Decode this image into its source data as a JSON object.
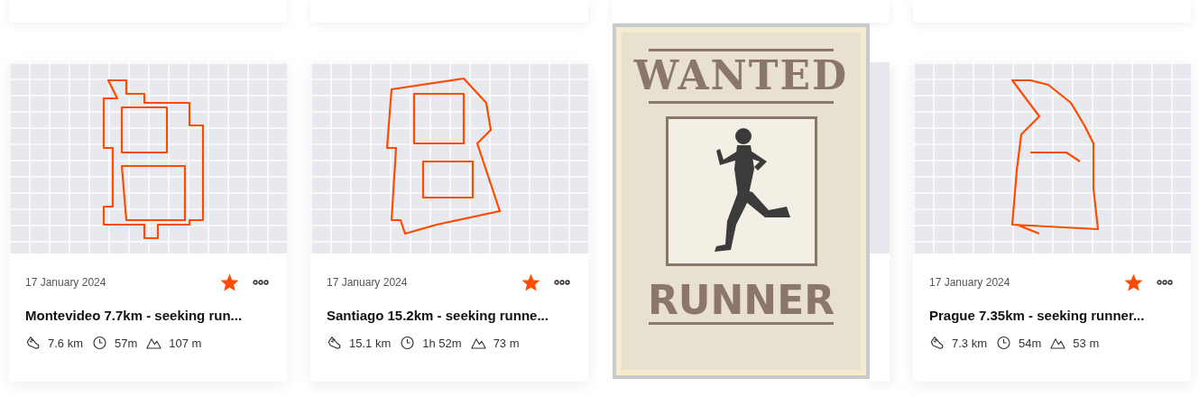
{
  "activities": [
    {
      "kind": "activity",
      "date": "17 January 2024",
      "title": "Montevideo 7.7km - seeking run...",
      "starred": true,
      "distance": "7.6 km",
      "duration": "57m",
      "elevation": "107 m"
    },
    {
      "kind": "activity",
      "date": "17 January 2024",
      "title": "Santiago 15.2km - seeking runne...",
      "starred": true,
      "distance": "15.1 km",
      "duration": "1h 52m",
      "elevation": "73 m"
    },
    {
      "kind": "covered"
    },
    {
      "kind": "activity",
      "date": "17 January 2024",
      "title": "Prague 7.35km - seeking runner...",
      "starred": true,
      "distance": "7.3 km",
      "duration": "54m",
      "elevation": "53 m"
    }
  ],
  "poster": {
    "heading": "WANTED",
    "caption": "RUNNER"
  }
}
